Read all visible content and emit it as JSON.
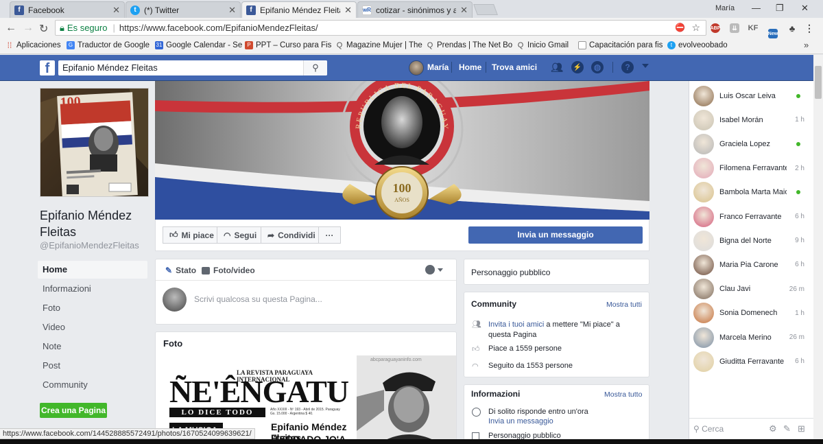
{
  "browser": {
    "tabs": [
      {
        "title": "Facebook",
        "icon": "facebook-favicon"
      },
      {
        "title": "(*) Twitter",
        "icon": "twitter-favicon"
      },
      {
        "title": "Epifanio Méndez Fleitas",
        "icon": "facebook-favicon",
        "active": true
      },
      {
        "title": "cotizar - sinónimos y ant",
        "icon": "wordreference-favicon"
      }
    ],
    "user_label": "María",
    "security_label": "Es seguro",
    "url": "https://www.facebook.com/EpifanioMendezFleitas/",
    "extensions": [
      "ABP",
      "KF",
      "New"
    ],
    "bookmarks": [
      "Aplicaciones",
      "Traductor de Google",
      "Google Calendar - Se",
      "PPT – Curso para Fis",
      "Magazine Mujer | The",
      "Prendas | The Net Bo",
      "Inicio Gmail",
      "Capacitación para fis",
      "evolveoobado"
    ],
    "status_url": "https://www.facebook.com/144528885572491/photos/1670524099639621/"
  },
  "fb": {
    "search_value": "Epifanio Méndez Fleitas",
    "user_name": "María",
    "nav_home": "Home",
    "nav_friends": "Trova amici"
  },
  "page": {
    "name": "Epifanio Méndez Fleitas",
    "handle": "@EpifanioMendezFleitas",
    "left_nav": [
      "Home",
      "Informazioni",
      "Foto",
      "Video",
      "Note",
      "Post",
      "Community"
    ],
    "create_page": "Crea una Pagina",
    "cover_seal_text": "REPUBLICA DEL PARAGUAY",
    "cover_badge_number": "100",
    "cover_badge_text": "AÑOS",
    "actions": {
      "like": "Mi piace",
      "follow": "Segui",
      "share": "Condividi",
      "more": "···",
      "message": "Invia un messaggio"
    },
    "composer": {
      "status_tab": "Stato",
      "photo_tab": "Foto/video",
      "placeholder": "Scrivi qualcosa su questa Pagina..."
    },
    "photos": {
      "title": "Foto",
      "magazine_subtitle": "LA REVISTA PARAGUAYA INTERNACIONAL",
      "magazine_title": "ÑE'ÊNGATU",
      "magazine_slogan": "LO DICE TODO",
      "magazine_issue": "Año XXXIII - Nº 193 - Abril de 2015. Paraguay Gs. 15.000 - Argentina $ 40.",
      "magazine_band": "LA MUSICA",
      "magazine_headline": "Epifanio Méndez Fleitas",
      "magazine_headline2": "TERRADO JO'A",
      "second_photo_watermark": "abcparaguayaninfo.com"
    },
    "category": "Personaggio pubblico",
    "community": {
      "title": "Community",
      "see_all": "Mostra tutti",
      "invite_link": "Invita i tuoi amici",
      "invite_rest": "a mettere \"Mi piace\" a questa Pagina",
      "likes": "Piace a 1559 persone",
      "follows": "Seguito da 1553 persone"
    },
    "info": {
      "title": "Informazioni",
      "see_all": "Mostra tutto",
      "responds": "Di solito risponde entro un'ora",
      "message_link": "Invia un messaggio",
      "category": "Personaggio pubblico"
    }
  },
  "chat": {
    "contacts": [
      {
        "name": "Luis Oscar Leiva",
        "status": "",
        "online": true,
        "color": "#8a6a4a"
      },
      {
        "name": "Isabel Morán",
        "status": "1 h",
        "online": false,
        "color": "#c9c3b2"
      },
      {
        "name": "Graciela Lopez",
        "status": "",
        "online": true,
        "color": "#b5b5b5"
      },
      {
        "name": "Filomena Ferravante",
        "status": "2 h",
        "online": false,
        "color": "#e3a8b8"
      },
      {
        "name": "Bambola Marta Maiol...",
        "status": "",
        "online": true,
        "color": "#d8c18a"
      },
      {
        "name": "Franco Ferravante",
        "status": "6 h",
        "online": false,
        "color": "#d45d7c"
      },
      {
        "name": "Bigna del Norte",
        "status": "9 h",
        "online": false,
        "color": "#dcdcdc"
      },
      {
        "name": "Maria Pia Carone",
        "status": "6 h",
        "online": false,
        "color": "#6a4a3a"
      },
      {
        "name": "Clau Javi",
        "status": "26 m",
        "online": false,
        "color": "#7d6a5a"
      },
      {
        "name": "Sonia Domenech",
        "status": "1 h",
        "online": false,
        "color": "#c4703a"
      },
      {
        "name": "Marcela Merino",
        "status": "26 m",
        "online": false,
        "color": "#7a8fa5"
      },
      {
        "name": "Giuditta Ferravante",
        "status": "6 h",
        "online": false,
        "color": "#e0cfa0"
      }
    ],
    "search_placeholder": "Cerca"
  }
}
